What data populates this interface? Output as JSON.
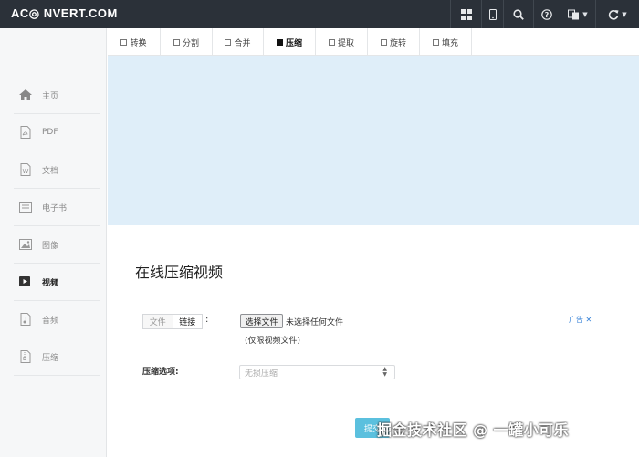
{
  "header": {
    "logo": "AC◎ NVERT.COM",
    "buttons": [
      {
        "icon": "grid-icon"
      },
      {
        "icon": "mobile-icon"
      },
      {
        "icon": "search-icon"
      },
      {
        "icon": "help-icon"
      },
      {
        "icon": "language-icon"
      },
      {
        "icon": "refresh-icon"
      }
    ]
  },
  "sidebar": {
    "items": [
      {
        "label": "主页",
        "icon": "home-icon"
      },
      {
        "label": "PDF",
        "icon": "pdf-icon"
      },
      {
        "label": "文档",
        "icon": "document-icon"
      },
      {
        "label": "电子书",
        "icon": "ebook-icon"
      },
      {
        "label": "图像",
        "icon": "image-icon"
      },
      {
        "label": "视频",
        "icon": "video-icon",
        "active": true
      },
      {
        "label": "音频",
        "icon": "audio-icon"
      },
      {
        "label": "压缩",
        "icon": "archive-icon"
      }
    ]
  },
  "tabs": [
    {
      "label": "转换"
    },
    {
      "label": "分割"
    },
    {
      "label": "合并"
    },
    {
      "label": "压缩",
      "active": true
    },
    {
      "label": "提取"
    },
    {
      "label": "旋转"
    },
    {
      "label": "填充"
    }
  ],
  "main": {
    "title": "在线压缩视频",
    "source_tabs": {
      "file": "文件",
      "link": "链接"
    },
    "colon": ":",
    "file_button": "选择文件",
    "file_status": "未选择任何文件",
    "file_hint": "(仅限视频文件)",
    "ad_label": "广告 ✕",
    "options_label": "压缩选项:",
    "select_value": "无损压缩",
    "submit_label": "提交"
  },
  "watermark": "掘金技术社区 @ 一罐小可乐",
  "colors": {
    "navbar": "#2b3139",
    "banner": "#dfeef9",
    "submit": "#5bc0de",
    "ad_link": "#2f7dd6"
  }
}
